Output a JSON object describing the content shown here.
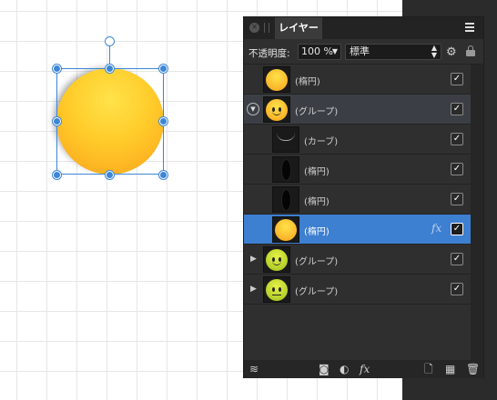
{
  "panel": {
    "tab_label": "レイヤー",
    "opacity_label": "不透明度:",
    "opacity_value": "100 %",
    "blend_mode": "標準"
  },
  "layers": [
    {
      "name": "(楕円)",
      "thumb": "yellow-circle",
      "visible": true,
      "expander": "none",
      "selected": false
    },
    {
      "name": "(グループ)",
      "thumb": "smiley",
      "visible": true,
      "expander": "open",
      "selected": false
    },
    {
      "name": "(カーブ)",
      "thumb": "curve",
      "visible": true,
      "expander": "none",
      "selected": false
    },
    {
      "name": "(楕円)",
      "thumb": "black-oval",
      "visible": true,
      "expander": "none",
      "selected": false
    },
    {
      "name": "(楕円)",
      "thumb": "black-oval",
      "visible": true,
      "expander": "none",
      "selected": false
    },
    {
      "name": "(楕円)",
      "thumb": "yellow-circle",
      "visible": true,
      "expander": "none",
      "selected": true,
      "fx": "fx"
    },
    {
      "name": "(グループ)",
      "thumb": "green-smiley",
      "visible": true,
      "expander": "collapsed",
      "selected": false
    },
    {
      "name": "(グループ)",
      "thumb": "green-smiley",
      "visible": true,
      "expander": "collapsed",
      "selected": false
    }
  ],
  "checkmark": "✓",
  "colors": {
    "selection_blue": "#3d7fd1",
    "handle_blue": "#3d86d6",
    "panel_bg": "#2f2f2f"
  },
  "bottom_bar": {
    "fx_label": "fx"
  }
}
